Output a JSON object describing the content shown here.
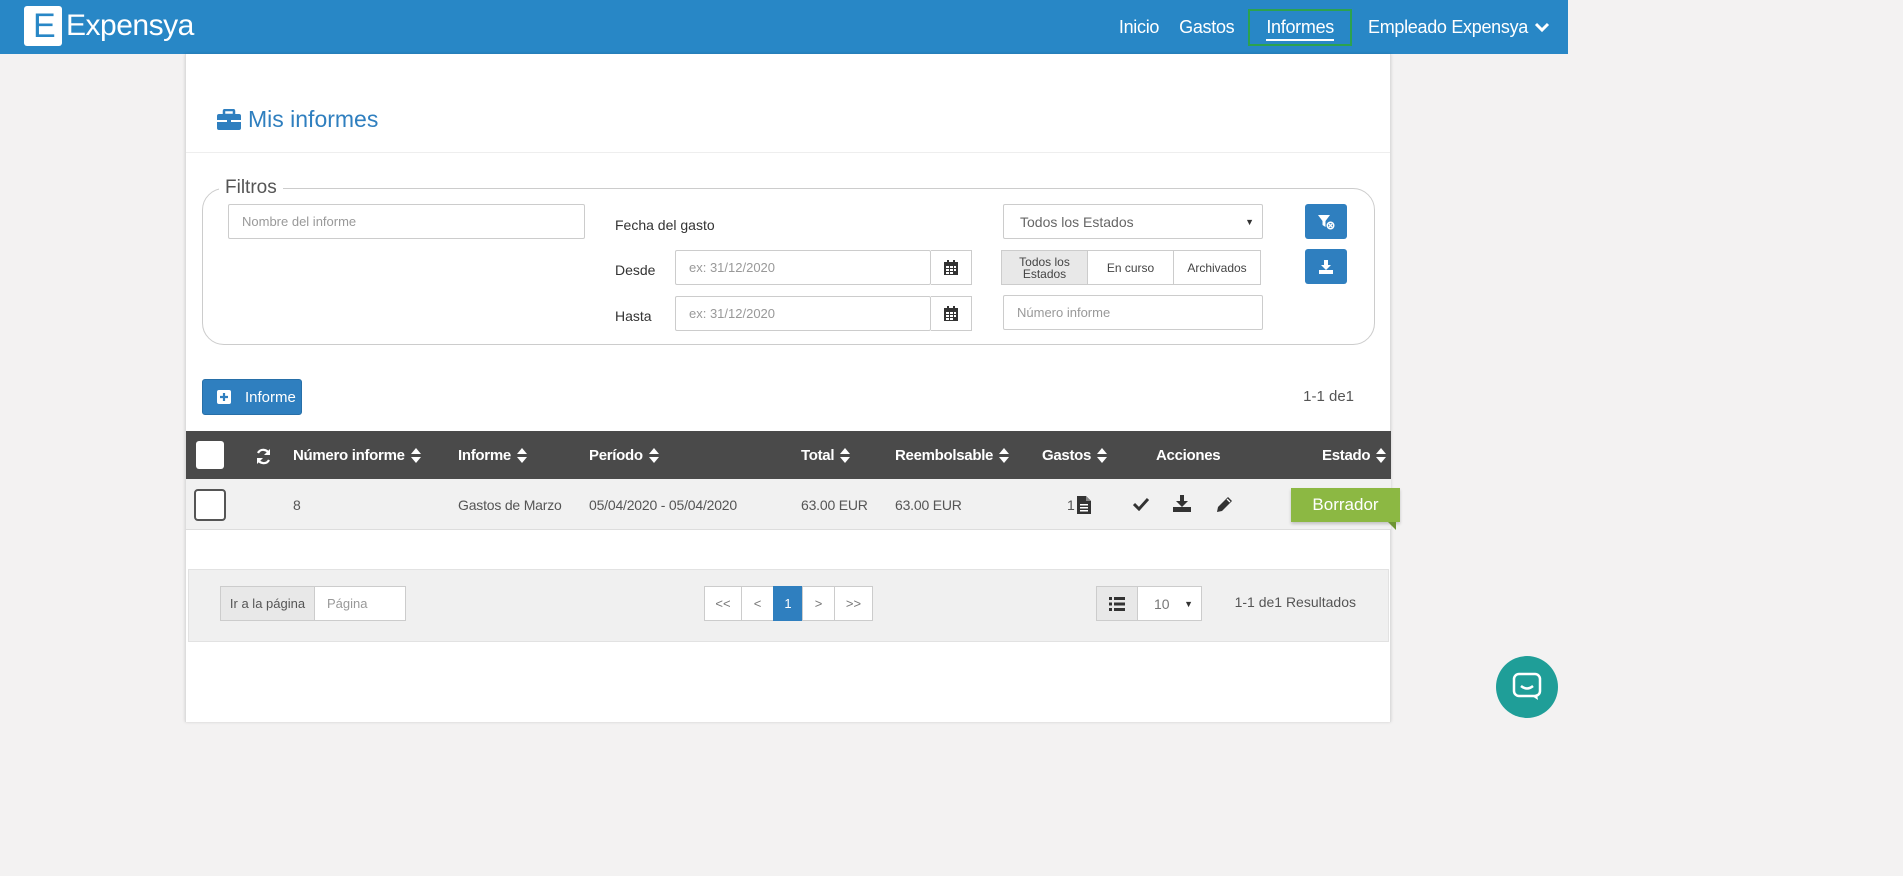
{
  "app": {
    "logo_letter": "E",
    "logo_text": "Expensya"
  },
  "nav": {
    "links": [
      "Inicio",
      "Gastos",
      "Informes"
    ],
    "user": "Empleado Expensya"
  },
  "page": {
    "title": "Mis informes"
  },
  "filters": {
    "legend": "Filtros",
    "report_name_placeholder": "Nombre del informe",
    "date_heading": "Fecha del gasto",
    "from_label": "Desde",
    "to_label": "Hasta",
    "from_placeholder": "ex: 31/12/2020",
    "to_placeholder": "ex: 31/12/2020",
    "state_select": "Todos los Estados",
    "state_tabs": [
      "Todos los Estados",
      "En curso",
      "Archivados"
    ],
    "report_number_placeholder": "Número informe"
  },
  "toolbar": {
    "add_label": "Informe",
    "range": "1-1 de1"
  },
  "table": {
    "headers": [
      "Número informe",
      "Informe",
      "Período",
      "Total",
      "Reembolsable",
      "Gastos",
      "Acciones",
      "Estado"
    ],
    "rows": [
      {
        "number": "8",
        "name": "Gastos de Marzo",
        "period": "05/04/2020 - 05/04/2020",
        "total": "63.00 EUR",
        "refundable": "63.00 EUR",
        "expenses": "1",
        "status": "Borrador"
      }
    ]
  },
  "pager": {
    "goto_label": "Ir a la página",
    "goto_placeholder": "Página",
    "buttons": [
      "<<",
      "<",
      "1",
      ">",
      ">>"
    ],
    "per_page": "10",
    "results": "1-1 de1 Resultados"
  },
  "colors": {
    "primary": "#2f7fbf",
    "navbar": "#2887c6",
    "status_draft": "#8cb843",
    "active_nav_border": "#2ca24e",
    "chat": "#1f9e98"
  }
}
